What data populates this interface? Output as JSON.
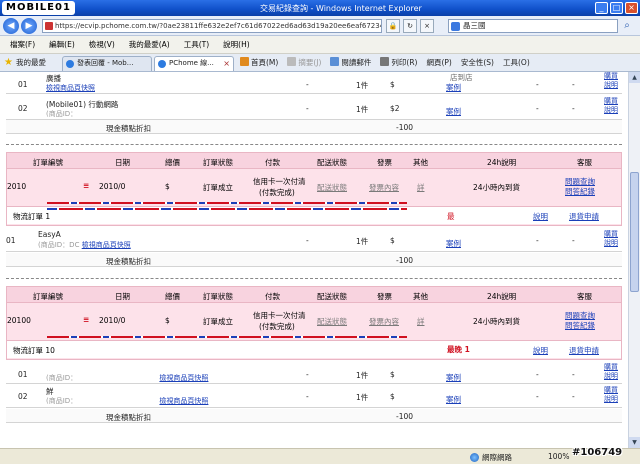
{
  "window": {
    "logo_text": "MOBILE01",
    "title": "交易紀錄查詢 - Windows Internet Explorer",
    "address": "https://ecvip.pchome.com.tw/?0ae23811ffe632e2ef7c61d67022ed6ad63d19a20ee6eaf67234e5cf7f",
    "search_value": "晶三國"
  },
  "menu": [
    "檔案(F)",
    "編輯(E)",
    "檢視(V)",
    "我的最愛(A)",
    "工具(T)",
    "說明(H)"
  ],
  "tabs": {
    "favorites_label": "我的最愛",
    "items": [
      {
        "label": "發表回覆 - Mob..."
      },
      {
        "label": "PChome 線..."
      }
    ]
  },
  "commands": {
    "home": "首頁(M)",
    "feeds": "摘要(J)",
    "read_mail": "閱讀郵件",
    "print": "列印(R)",
    "page": "網頁(P)",
    "safety": "安全性(S)",
    "tools": "工具(O)"
  },
  "headers": {
    "order_no": "訂單編號",
    "date": "日期",
    "total": "總價",
    "status": "訂單狀態",
    "payment": "付款",
    "delivery": "配送狀態",
    "invoice": "發票",
    "other": "其他",
    "notes": "24h說明",
    "service": "客服"
  },
  "top_section": {
    "products": [
      {
        "num": "01",
        "name": "廣播",
        "id_link": "檢視商品頁快照",
        "dash1": "-",
        "qty": "1件",
        "price": "$",
        "review_label": "店到店",
        "review_link": "案例",
        "dash2": "-",
        "dash3": "-",
        "link1": "購買",
        "link2": "說明"
      },
      {
        "num": "02",
        "name": "(Mobile01) 行動網路",
        "id_text": "(商品ID：",
        "dash1": "-",
        "qty": "1件",
        "price": "$2",
        "review_link": "案例",
        "dash2": "-",
        "dash3": "-",
        "link1": "購買",
        "link2": "說明"
      }
    ],
    "total_label": "現金積點折扣",
    "total_value": "-100"
  },
  "orders": [
    {
      "order_no": "2010",
      "date": "2010/0",
      "total": "$",
      "status": "訂單成立",
      "payment_line1": "信用卡一次付清",
      "payment_line2": "(付款完成)",
      "delivery": "配送狀態",
      "invoice": "發票內容",
      "other": "詳",
      "notes": "24小時內到貨",
      "service1": "問題查詢",
      "service2": "問答紀錄",
      "lane_label": "物流訂單 1",
      "lane_text": "最",
      "lane_help": "說明",
      "lane_service": "退貨申請",
      "products": [
        {
          "num": "01",
          "name": "EasyA",
          "id_text": "(商品ID：DC",
          "id_link": "檢視商品頁快照",
          "dash1": "-",
          "qty": "1件",
          "price": "$",
          "review_link": "案例",
          "dash2": "-",
          "dash3": "-",
          "link1": "購買",
          "link2": "說明"
        }
      ],
      "total_label": "現金積點折扣",
      "total_value": "-100"
    },
    {
      "order_no": "20100",
      "date": "2010/0",
      "total": "$",
      "status": "訂單成立",
      "payment_line1": "信用卡一次付清",
      "payment_line2": "(付款完成)",
      "delivery": "配送狀態",
      "invoice": "發票內容",
      "other": "詳",
      "notes": "24小時內到貨",
      "service1": "問題查詢",
      "service2": "問答紀錄",
      "lane_label": "物流訂單 10",
      "lane_text": "最晚 1",
      "lane_help": "說明",
      "lane_service": "退貨申請",
      "products": [
        {
          "num": "01",
          "name": "",
          "id_text": "(商品ID：",
          "id_link": "檢視商品頁快照",
          "dash1": "-",
          "qty": "1件",
          "price": "$",
          "review_link": "案例",
          "dash2": "-",
          "dash3": "-",
          "link1": "購買",
          "link2": "說明"
        },
        {
          "num": "02",
          "name": "鮮",
          "id_text": "(商品ID：",
          "id_link": "檢視商品頁快照",
          "dash1": "-",
          "qty": "1件",
          "price": "$",
          "review_link": "案例",
          "dash2": "-",
          "dash3": "-",
          "link1": "購買",
          "link2": "說明"
        }
      ],
      "total_label": "現金積點折扣",
      "total_value": "-100"
    }
  ],
  "status": {
    "zone": "網際網路",
    "zoom": "100%"
  },
  "watermark": "#106749",
  "colors": {
    "order_bg": "#fde2ea",
    "order_header": "#f8d3df",
    "link": "#1a3fb8",
    "alert": "#d01020"
  }
}
